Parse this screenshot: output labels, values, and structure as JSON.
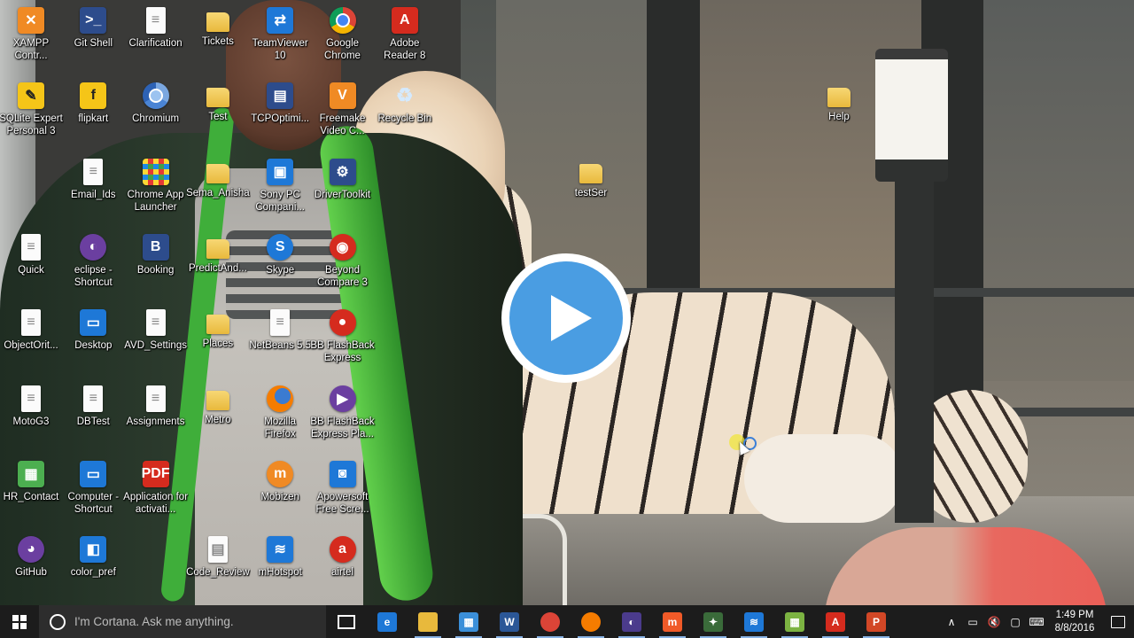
{
  "desktop": {
    "icons": [
      {
        "label": "XAMPP Contr...",
        "icon": "xampp-icon",
        "glyph": "✕",
        "style": "g-orange"
      },
      {
        "label": "Git Shell",
        "icon": "git-shell-icon",
        "glyph": ">_",
        "style": "g-dark"
      },
      {
        "label": "Clarification",
        "icon": "document-icon",
        "glyph": "≡",
        "style": "g-doc"
      },
      {
        "label": "Tickets",
        "icon": "folder-icon",
        "glyph": "",
        "style": "g-folder"
      },
      {
        "label": "TeamViewer 10",
        "icon": "teamviewer-icon",
        "glyph": "⇄",
        "style": "g-blue"
      },
      {
        "label": "Google Chrome",
        "icon": "chrome-icon",
        "glyph": "",
        "style": "g-chrome"
      },
      {
        "label": "Adobe Reader 8",
        "icon": "adobe-reader-icon",
        "glyph": "A",
        "style": "g-red"
      },
      {
        "label": "SQLite Expert Personal 3",
        "icon": "sqlite-expert-icon",
        "glyph": "✎",
        "style": "g-yellow"
      },
      {
        "label": "flipkart",
        "icon": "flipkart-icon",
        "glyph": "f",
        "style": "g-yellow"
      },
      {
        "label": "Chromium",
        "icon": "chromium-icon",
        "glyph": "",
        "style": "g-chromium"
      },
      {
        "label": "Test",
        "icon": "folder-icon",
        "glyph": "",
        "style": "g-folder"
      },
      {
        "label": "TCPOptimi...",
        "icon": "tcp-optimizer-icon",
        "glyph": "▤",
        "style": "g-dark"
      },
      {
        "label": "Freemake Video C...",
        "icon": "freemake-icon",
        "glyph": "V",
        "style": "g-orange"
      },
      {
        "label": "Recycle Bin",
        "icon": "recycle-bin-icon",
        "glyph": "♻",
        "style": "g-bin"
      },
      {
        "label": "Help",
        "icon": "folder-icon",
        "glyph": "",
        "style": "g-folder"
      },
      {
        "label": "Email_Ids",
        "icon": "document-icon",
        "glyph": "≡",
        "style": "g-doc"
      },
      {
        "label": "Chrome App Launcher",
        "icon": "app-launcher-icon",
        "glyph": "",
        "style": "g-apps"
      },
      {
        "label": "Sema_Anisha",
        "icon": "folder-icon",
        "glyph": "",
        "style": "g-folder"
      },
      {
        "label": "Sony PC Compani...",
        "icon": "sony-pc-companion-icon",
        "glyph": "▣",
        "style": "g-blue"
      },
      {
        "label": "DriverToolkit",
        "icon": "driver-toolkit-icon",
        "glyph": "⚙",
        "style": "g-dark"
      },
      {
        "label": "testSer",
        "icon": "folder-icon",
        "glyph": "",
        "style": "g-folder"
      },
      {
        "label": "Quick",
        "icon": "document-icon",
        "glyph": "≡",
        "style": "g-doc"
      },
      {
        "label": "eclipse - Shortcut",
        "icon": "eclipse-icon",
        "glyph": "◐",
        "style": "g-purple g-circle"
      },
      {
        "label": "Booking",
        "icon": "booking-icon",
        "glyph": "B",
        "style": "g-dark"
      },
      {
        "label": "PredictAnd...",
        "icon": "folder-icon",
        "glyph": "",
        "style": "g-folder"
      },
      {
        "label": "Skype",
        "icon": "skype-icon",
        "glyph": "S",
        "style": "g-blue g-circle"
      },
      {
        "label": "Beyond Compare 3",
        "icon": "beyond-compare-icon",
        "glyph": "◉",
        "style": "g-red g-circle"
      },
      {
        "label": "ObjectOrit...",
        "icon": "document-icon",
        "glyph": "≡",
        "style": "g-doc"
      },
      {
        "label": "Desktop",
        "icon": "desktop-icon",
        "glyph": "▭",
        "style": "g-blue"
      },
      {
        "label": "AVD_Settings",
        "icon": "document-icon",
        "glyph": "≡",
        "style": "g-doc"
      },
      {
        "label": "Places",
        "icon": "folder-icon",
        "glyph": "",
        "style": "g-folder"
      },
      {
        "label": "NetBeans 5.5",
        "icon": "document-icon",
        "glyph": "≡",
        "style": "g-doc"
      },
      {
        "label": "BB FlashBack Express Rec...",
        "icon": "bb-flashback-recorder-icon",
        "glyph": "●",
        "style": "g-red g-circle"
      },
      {
        "label": "MotoG3",
        "icon": "document-icon",
        "glyph": "≡",
        "style": "g-doc"
      },
      {
        "label": "DBTest",
        "icon": "document-icon",
        "glyph": "≡",
        "style": "g-doc"
      },
      {
        "label": "Assignments",
        "icon": "document-icon",
        "glyph": "≡",
        "style": "g-doc"
      },
      {
        "label": "Metro",
        "icon": "folder-icon",
        "glyph": "",
        "style": "g-folder"
      },
      {
        "label": "Mozilla Firefox",
        "icon": "firefox-icon",
        "glyph": "",
        "style": "g-firefox"
      },
      {
        "label": "BB FlashBack Express Pla...",
        "icon": "bb-flashback-player-icon",
        "glyph": "▶",
        "style": "g-purple g-circle"
      },
      {
        "label": "HR_Contact",
        "icon": "spreadsheet-icon",
        "glyph": "▦",
        "style": "g-green"
      },
      {
        "label": "Computer - Shortcut",
        "icon": "computer-icon",
        "glyph": "▭",
        "style": "g-blue"
      },
      {
        "label": "Application for activati...",
        "icon": "pdf-icon",
        "glyph": "PDF",
        "style": "g-red"
      },
      {
        "label": "Mobizen",
        "icon": "mobizen-icon",
        "glyph": "m",
        "style": "g-orange g-circle"
      },
      {
        "label": "Apowersoft Free Scre...",
        "icon": "apowersoft-icon",
        "glyph": "◙",
        "style": "g-blue"
      },
      {
        "label": "GitHub",
        "icon": "github-icon",
        "glyph": "◕",
        "style": "g-purple g-circle"
      },
      {
        "label": "color_pref",
        "icon": "color-pref-icon",
        "glyph": "◧",
        "style": "g-blue"
      },
      {
        "label": "Code_Review",
        "icon": "code-review-icon",
        "glyph": "▤",
        "style": "g-doc"
      },
      {
        "label": "mHotspot",
        "icon": "mhotspot-icon",
        "glyph": "≋",
        "style": "g-blue"
      },
      {
        "label": "airtel",
        "icon": "airtel-icon",
        "glyph": "a",
        "style": "g-red g-circle"
      }
    ]
  },
  "overlay": {
    "play_icon": "play-icon"
  },
  "taskbar": {
    "search_placeholder": "I'm Cortana. Ask me anything.",
    "apps": [
      {
        "name": "task-view",
        "icon": "task-view-icon",
        "color": "#1c1c1c",
        "glyph": ""
      },
      {
        "name": "edge",
        "icon": "edge-icon",
        "color": "#1e78d7",
        "glyph": "e"
      },
      {
        "name": "file-explorer",
        "icon": "folder-icon",
        "color": "#e8b93c",
        "glyph": ""
      },
      {
        "name": "store",
        "icon": "store-icon",
        "color": "#3b8fd9",
        "glyph": "▦"
      },
      {
        "name": "word",
        "icon": "word-icon",
        "color": "#2b5797",
        "glyph": "W"
      },
      {
        "name": "chrome",
        "icon": "chrome-icon",
        "color": "#db4437",
        "glyph": ""
      },
      {
        "name": "firefox",
        "icon": "firefox-icon",
        "color": "#f57c00",
        "glyph": ""
      },
      {
        "name": "eclipse",
        "icon": "eclipse-icon",
        "color": "#4b3b8c",
        "glyph": "◐"
      },
      {
        "name": "mobizen",
        "icon": "mobizen-icon",
        "color": "#f05a28",
        "glyph": "m"
      },
      {
        "name": "android-studio",
        "icon": "android-icon",
        "color": "#3a6b3a",
        "glyph": "✦"
      },
      {
        "name": "mhotspot",
        "icon": "mhotspot-icon",
        "color": "#1e78d7",
        "glyph": "≋"
      },
      {
        "name": "spreadsheet",
        "icon": "spreadsheet-icon",
        "color": "#7cb342",
        "glyph": "▦"
      },
      {
        "name": "adobe-reader",
        "icon": "adobe-reader-icon",
        "color": "#d52b1e",
        "glyph": "A"
      },
      {
        "name": "powerpoint",
        "icon": "powerpoint-icon",
        "color": "#d24726",
        "glyph": "P"
      }
    ],
    "tray": [
      {
        "icon": "chevron-up-icon",
        "glyph": "∧"
      },
      {
        "icon": "battery-icon",
        "glyph": "▭"
      },
      {
        "icon": "volume-muted-icon",
        "glyph": "🔇"
      },
      {
        "icon": "network-icon",
        "glyph": "▢"
      },
      {
        "icon": "keyboard-icon",
        "glyph": "⌨"
      }
    ],
    "time": "1:49 PM",
    "date": "8/8/2016"
  }
}
